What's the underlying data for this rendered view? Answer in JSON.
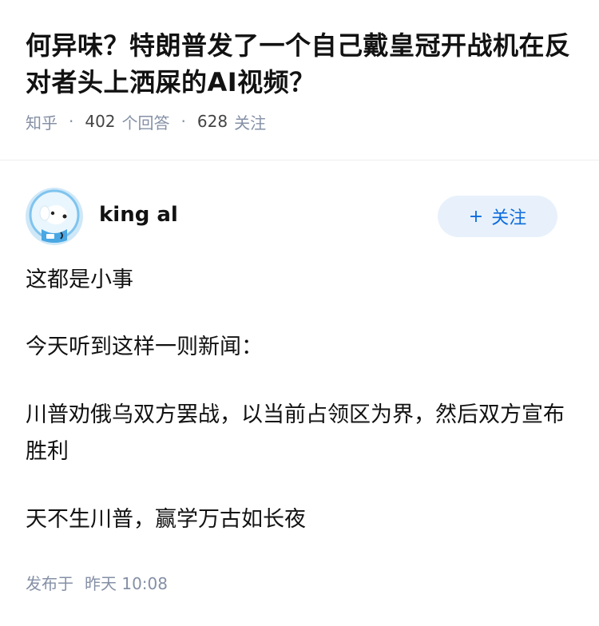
{
  "question": {
    "title": "何异味？特朗普发了一个自己戴皇冠开战机在反对者头上洒屎的AI视频？",
    "source": "知乎",
    "answers_count": "402",
    "answers_label": "个回答",
    "followers_count": "628",
    "followers_label": "关注"
  },
  "answer": {
    "author_name": "king al",
    "follow_button": {
      "icon": "+",
      "label": "关注"
    },
    "paragraphs": [
      "这都是小事",
      "今天听到这样一则新闻：",
      "川普劝俄乌双方罢战，以当前占领区为界，然后双方宣布胜利",
      "天不生川普，赢学万古如长夜"
    ],
    "publish_label": "发布于",
    "publish_time": "昨天 10:08"
  },
  "colors": {
    "text": "#121212",
    "meta": "#8590a6",
    "accent": "#0d6bdc",
    "follow_bg": "#e8f1fb"
  },
  "icons": {
    "avatar": "cartoon-dog-avatar"
  }
}
